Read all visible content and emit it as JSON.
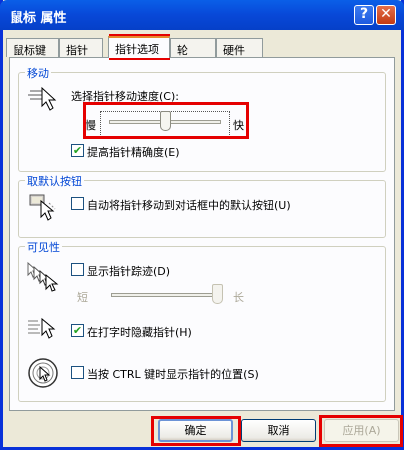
{
  "window": {
    "title": "鼠标 属性",
    "help_label": "?",
    "close_label": "✕"
  },
  "tabs": [
    {
      "label": "鼠标键"
    },
    {
      "label": "指针"
    },
    {
      "label": "指针选项"
    },
    {
      "label": "轮"
    },
    {
      "label": "硬件"
    }
  ],
  "motion": {
    "legend": "移动",
    "speed_label": "选择指针移动速度(C):",
    "slow_label": "慢",
    "fast_label": "快",
    "speed_level": 0.5,
    "precision_label": "提高指针精确度(E)",
    "precision_checked": true
  },
  "snap": {
    "legend": "取默认按钮",
    "snap_label": "自动将指针移动到对话框中的默认按钮(U)",
    "snap_checked": false
  },
  "visibility": {
    "legend": "可见性",
    "trails_label": "显示指针踪迹(D)",
    "trails_checked": false,
    "short_label": "短",
    "long_label": "长",
    "trails_level": 1.0,
    "hide_label": "在打字时隐藏指针(H)",
    "hide_checked": true,
    "ctrl_label": "当按 CTRL 键时显示指针的位置(S)",
    "ctrl_checked": false
  },
  "buttons": {
    "ok": "确定",
    "cancel": "取消",
    "apply": "应用(A)"
  },
  "colors": {
    "accent": "#0046D5",
    "titlebar": "#0848D8",
    "highlight_box": "#E50000",
    "checkmark": "#21A121"
  }
}
